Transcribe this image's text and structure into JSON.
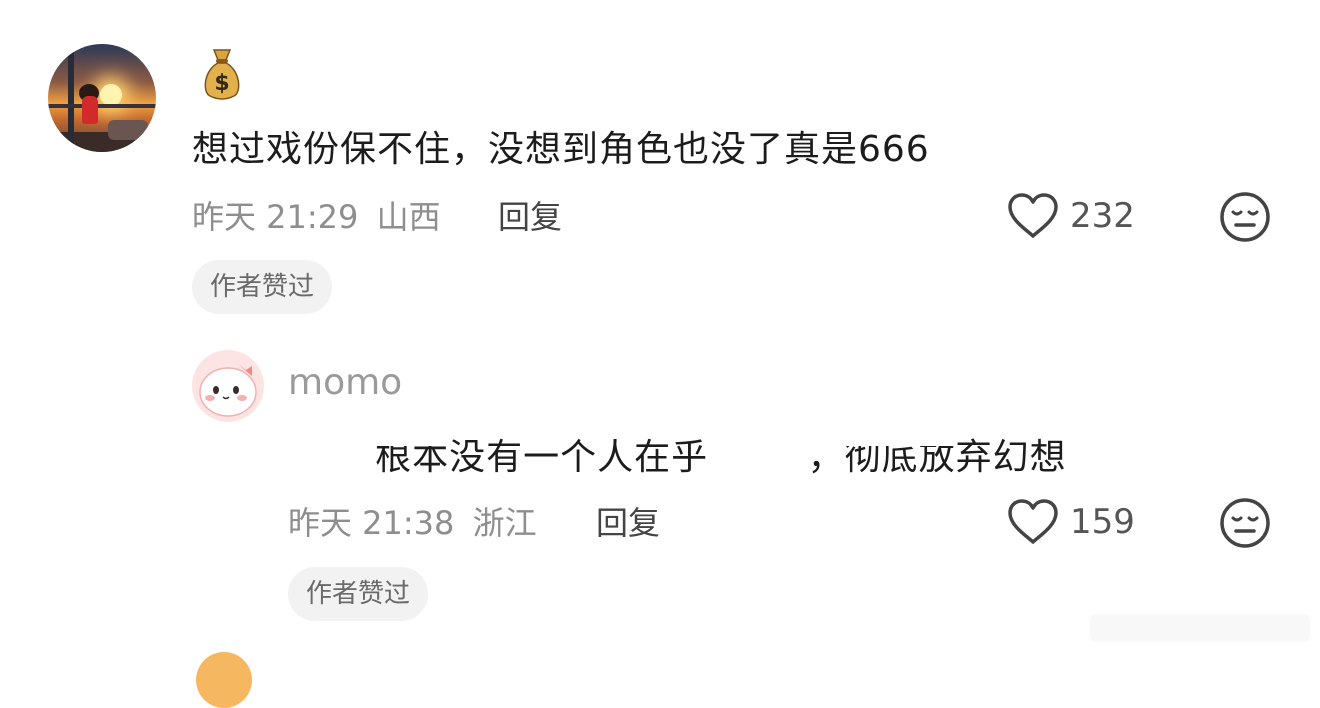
{
  "comment": {
    "emoji_icon": "money-bag-icon",
    "text": "想过戏份保不住，没想到角色也没了真是666",
    "time": "昨天 21:29",
    "location": "山西",
    "reply_label": "回复",
    "likes": "232",
    "author_badge": "作者赞过"
  },
  "reply": {
    "username": "momo",
    "text_visible_right": "，彻底放弃幻想",
    "text_visible_mid": "根本没有一个人在乎",
    "time": "昨天 21:38",
    "location": "浙江",
    "reply_label": "回复",
    "likes": "159",
    "author_badge": "作者赞过"
  },
  "colors": {
    "meta_gray": "#8e8e8e",
    "badge_bg": "#f2f2f2",
    "text_dark": "#1c1c1c"
  }
}
